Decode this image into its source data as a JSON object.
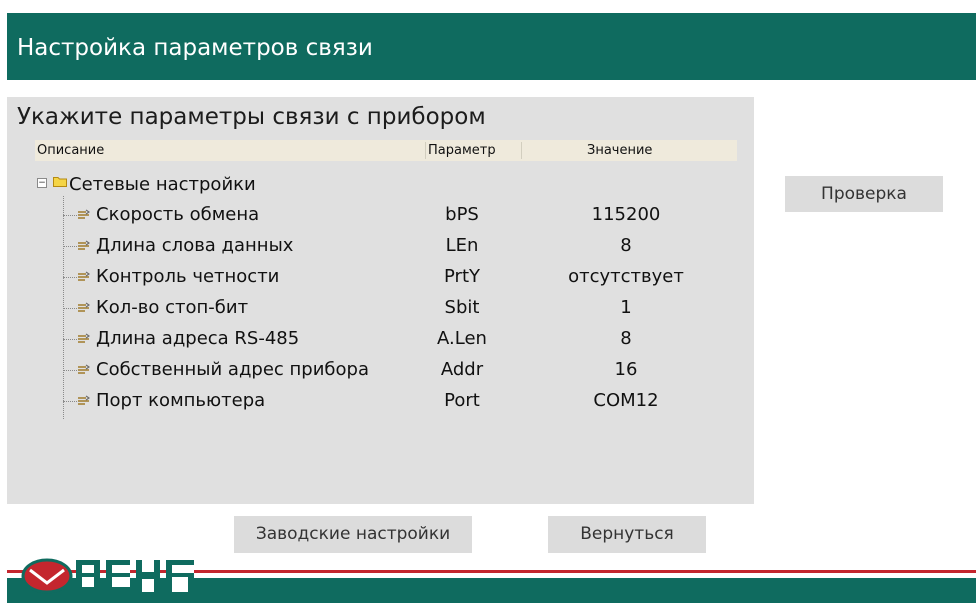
{
  "header": {
    "title": "Настройка параметров связи"
  },
  "panel": {
    "title": "Укажите параметры связи с прибором",
    "columns": {
      "description": "Описание",
      "parameter": "Параметр",
      "value": "Значение"
    },
    "tree": {
      "group_label": "Сетевые настройки",
      "group_expanded": true,
      "rows": [
        {
          "description": "Скорость обмена",
          "parameter": "bPS",
          "value": "115200"
        },
        {
          "description": "Длина слова данных",
          "parameter": "LEn",
          "value": "8"
        },
        {
          "description": "Контроль четности",
          "parameter": "PrtY",
          "value": "отсутствует"
        },
        {
          "description": "Кол-во стоп-бит",
          "parameter": "Sbit",
          "value": "1"
        },
        {
          "description": "Длина адреса RS-485",
          "parameter": "A.Len",
          "value": "8"
        },
        {
          "description": "Собственный адрес прибора",
          "parameter": "Addr",
          "value": "16"
        },
        {
          "description": "Порт компьютера",
          "parameter": "Port",
          "value": "COM12"
        }
      ]
    }
  },
  "buttons": {
    "check": "Проверка",
    "factory_settings": "Заводские настройки",
    "back": "Вернуться"
  },
  "logo": {
    "text": "ОВЕН"
  },
  "colors": {
    "brand_green": "#0f6b5f",
    "brand_red": "#c4262e",
    "panel_bg": "#e0e0e0"
  }
}
